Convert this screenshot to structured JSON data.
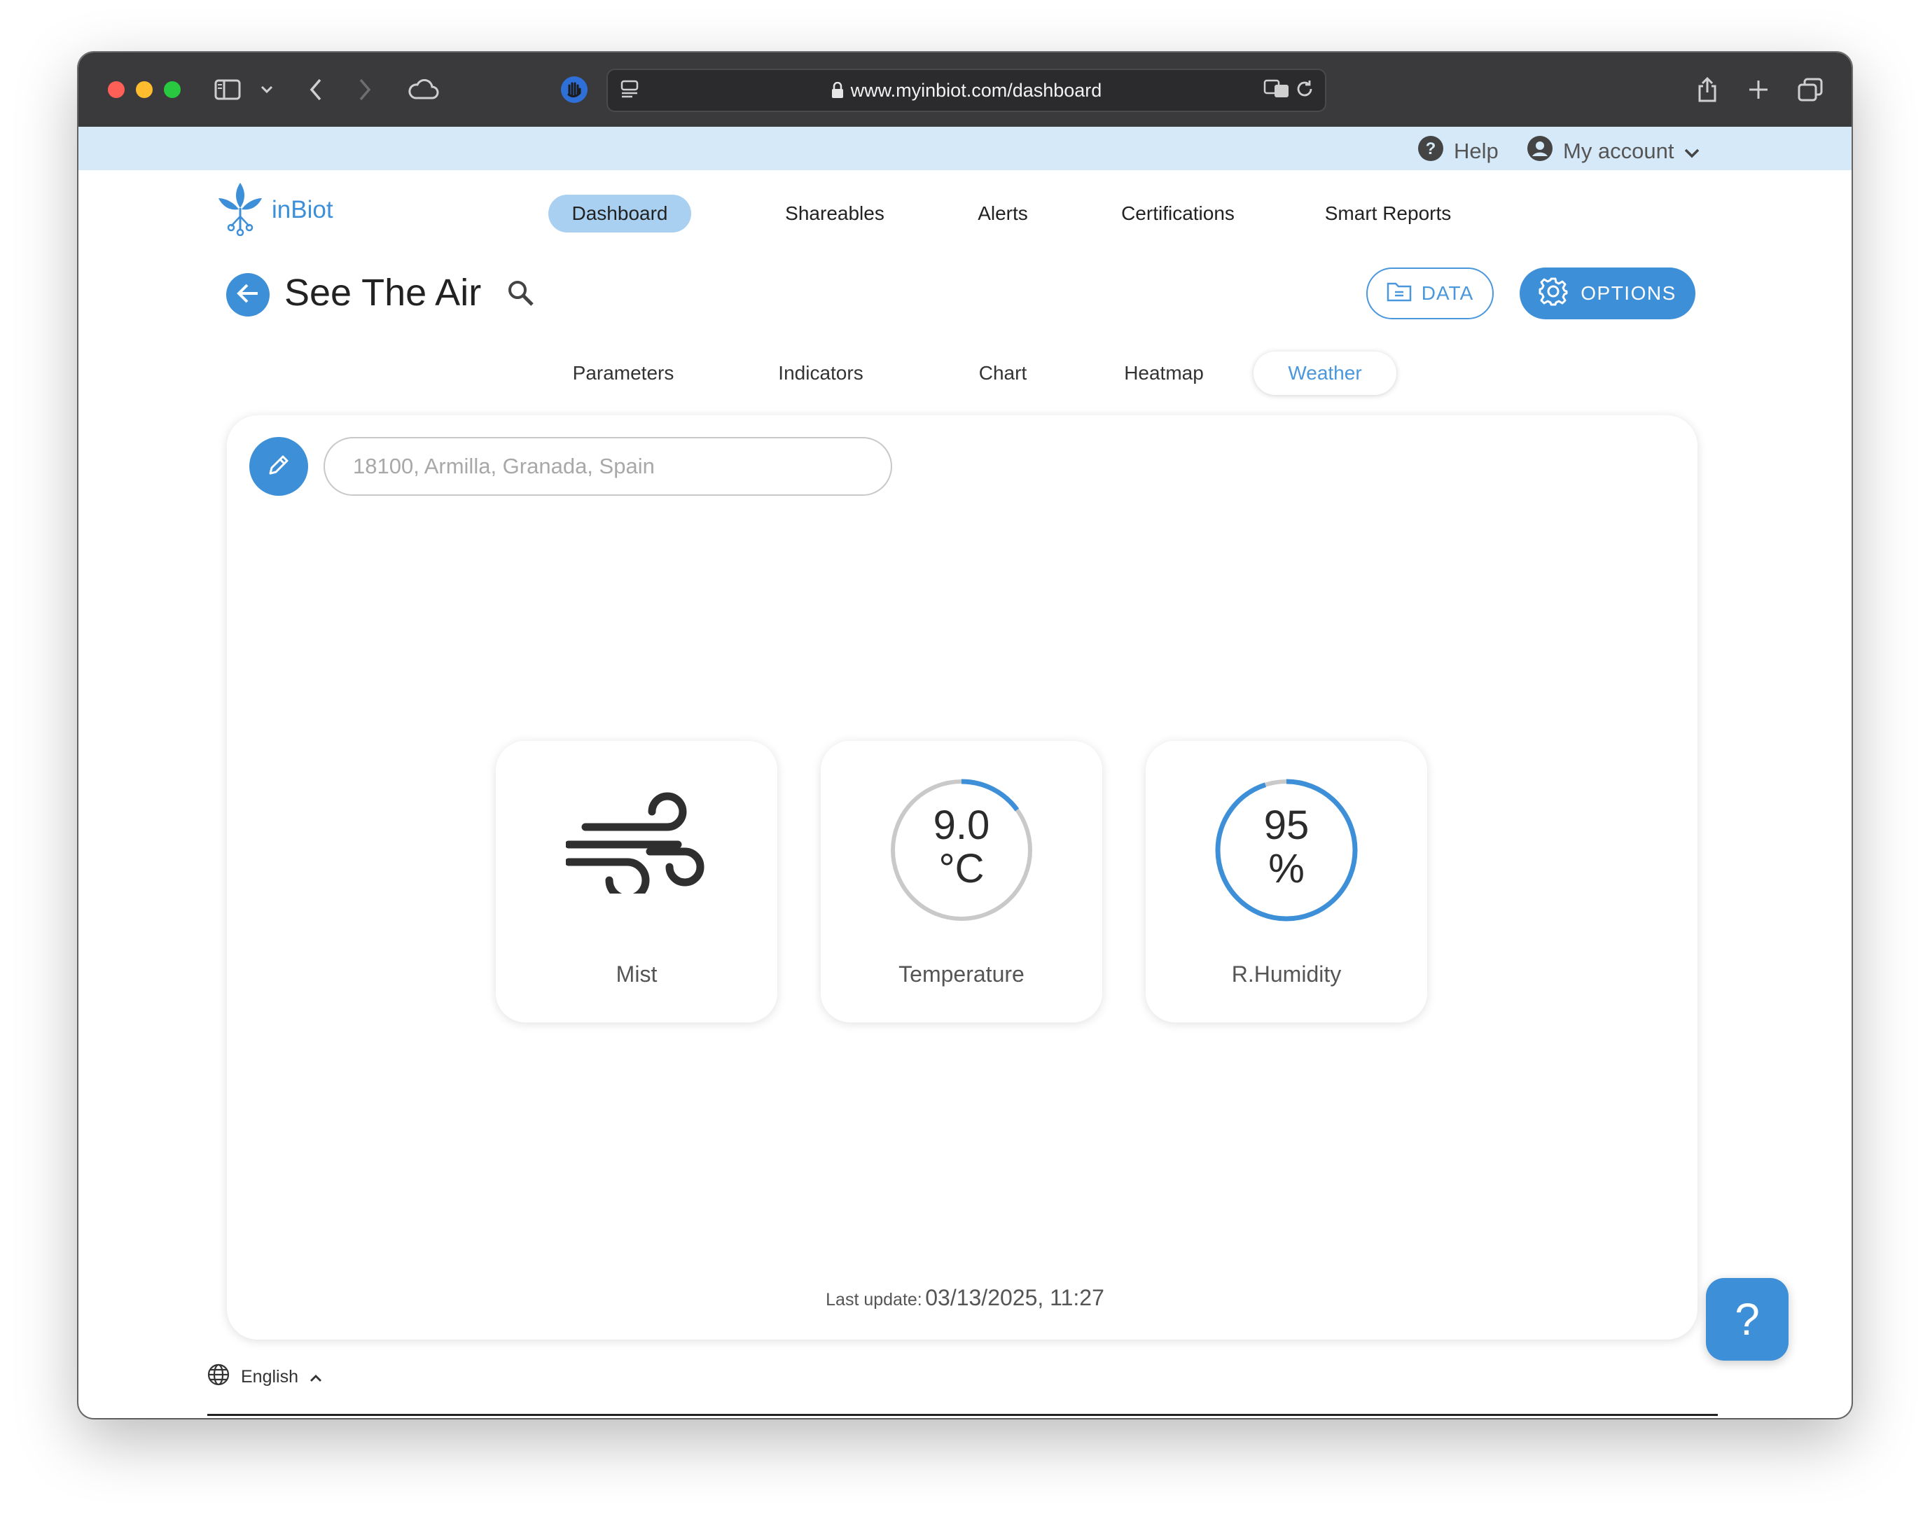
{
  "browser": {
    "url": "www.myinbiot.com/dashboard"
  },
  "account_bar": {
    "help_label": "Help",
    "account_label": "My account"
  },
  "brand": {
    "name": "inBiot"
  },
  "nav": {
    "items": [
      {
        "label": "Dashboard",
        "active": true
      },
      {
        "label": "Shareables",
        "active": false
      },
      {
        "label": "Alerts",
        "active": false
      },
      {
        "label": "Certifications",
        "active": false
      },
      {
        "label": "Smart Reports",
        "active": false
      }
    ]
  },
  "header": {
    "title": "See The Air",
    "data_button": "DATA",
    "options_button": "OPTIONS"
  },
  "subtabs": {
    "items": [
      {
        "label": "Parameters",
        "active": false
      },
      {
        "label": "Indicators",
        "active": false
      },
      {
        "label": "Chart",
        "active": false
      },
      {
        "label": "Heatmap",
        "active": false
      },
      {
        "label": "Weather",
        "active": true
      }
    ]
  },
  "weather": {
    "location_placeholder": "18100, Armilla, Granada, Spain",
    "condition": {
      "label": "Mist",
      "icon": "wind-icon"
    },
    "temperature": {
      "label": "Temperature",
      "value": "9.0",
      "unit": "°C",
      "fill_fraction": 0.15
    },
    "humidity": {
      "label": "R.Humidity",
      "value": "95",
      "unit": "%",
      "fill_fraction": 0.95
    },
    "last_update_label": "Last update:",
    "last_update_value": "03/13/2025, 11:27"
  },
  "footer": {
    "language": "English",
    "help_fab": "?"
  },
  "colors": {
    "accent": "#3d8fd8",
    "nav_active_bg": "#a9d0f1",
    "strip_bg": "#d6e9f8",
    "gauge_track": "#c9c9c9"
  }
}
